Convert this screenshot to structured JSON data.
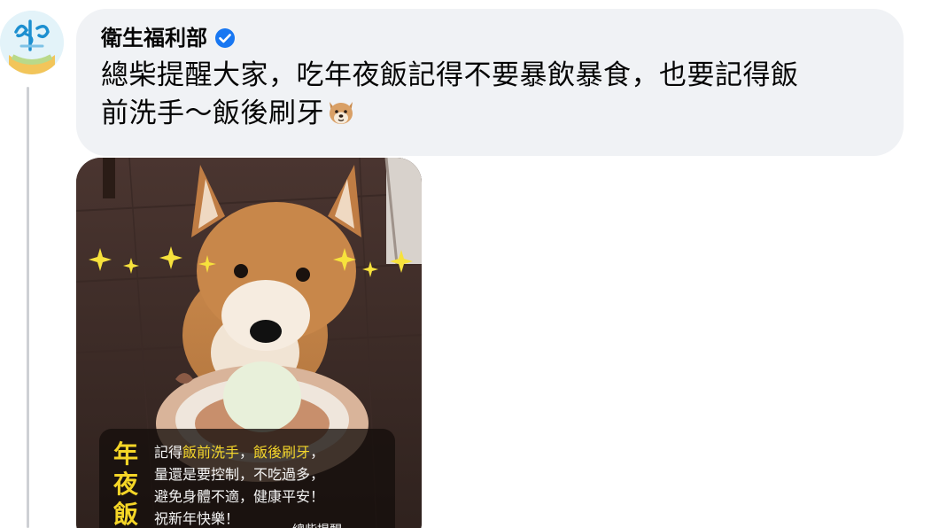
{
  "comment": {
    "author": "衛生福利部",
    "verified_icon": "verified-badge-icon",
    "text_line1": "總柴提醒大家，吃年夜飯記得不要暴飲暴食，也要記得飯",
    "text_line2": "前洗手～飯後刷牙",
    "emoji": "dog-face-emoji"
  },
  "attachment": {
    "image_subject": "shiba-inu-dog-photo",
    "caption": {
      "title_chars": [
        "年",
        "夜",
        "飯"
      ],
      "line1_pre": "記得",
      "line1_hl1": "飯前洗手",
      "line1_sep": "，",
      "line1_hl2": "飯後刷牙",
      "line1_post": "，",
      "line2": "量還是要控制，不吃過多，",
      "line3": "避免身體不適，健康平安！",
      "line4": "祝新年快樂！",
      "signature": "總柴提醒"
    }
  },
  "colors": {
    "bubble_bg": "#f0f2f5",
    "verified_blue": "#1877f2",
    "caption_highlight": "#f3d52b"
  }
}
